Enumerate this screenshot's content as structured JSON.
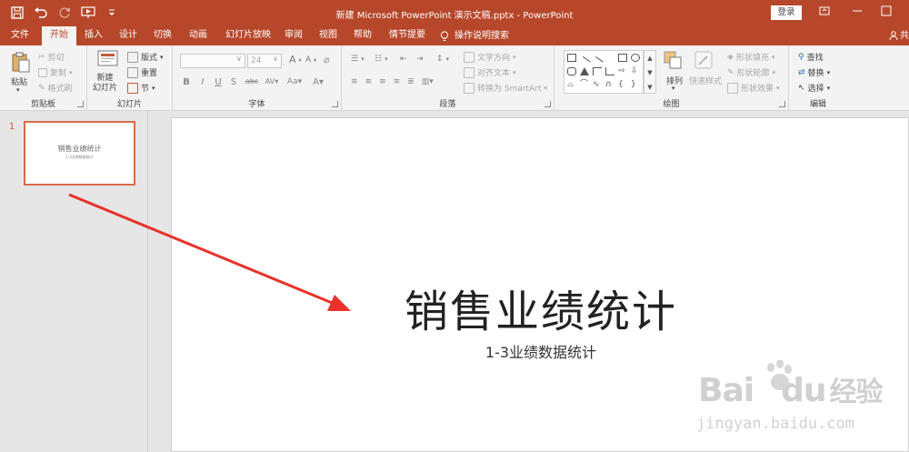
{
  "window": {
    "title": "新建 Microsoft PowerPoint 演示文稿.pptx  -  PowerPoint",
    "signin": "登录",
    "share_partial": "共"
  },
  "tabs": [
    {
      "label": "文件"
    },
    {
      "label": "开始"
    },
    {
      "label": "插入"
    },
    {
      "label": "设计"
    },
    {
      "label": "切换"
    },
    {
      "label": "动画"
    },
    {
      "label": "幻灯片放映"
    },
    {
      "label": "审阅"
    },
    {
      "label": "视图"
    },
    {
      "label": "帮助"
    },
    {
      "label": "情节提要"
    },
    {
      "label": "操作说明搜索"
    }
  ],
  "ribbon": {
    "clipboard": {
      "label": "剪贴板",
      "paste": "粘贴",
      "cut": "剪切",
      "copy": "复制",
      "format_painter": "格式刷"
    },
    "slides": {
      "label": "幻灯片",
      "new_slide_line1": "新建",
      "new_slide_line2": "幻灯片",
      "layout": "版式",
      "reset": "重置",
      "section": "节"
    },
    "font": {
      "label": "字体",
      "font_name": "",
      "font_size": "24",
      "bold": "B",
      "italic": "I",
      "underline": "U",
      "shadow": "S",
      "strike": "abc",
      "spacing": "AV",
      "case": "Aa",
      "grow": "A",
      "shrink": "A",
      "color": "A"
    },
    "paragraph": {
      "label": "段落",
      "text_direction": "文字方向",
      "align_text": "对齐文本",
      "convert_smartart": "转换为 SmartArt"
    },
    "drawing": {
      "label": "绘图",
      "arrange": "排列",
      "quick_styles": "快速样式",
      "shape_fill": "形状填充",
      "shape_outline": "形状轮廓",
      "shape_effects": "形状效果"
    },
    "editing": {
      "label": "编辑",
      "find": "查找",
      "replace": "替换",
      "select": "选择"
    }
  },
  "thumbnails": [
    {
      "number": "1",
      "title": "销售业绩统计",
      "subtitle": "1-3业绩数据统计"
    }
  ],
  "slide": {
    "title": "销售业绩统计",
    "subtitle": "1-3业绩数据统计"
  },
  "watermark": {
    "brand_a": "Bai",
    "brand_b": "du",
    "brand_c": "经验",
    "url": "jingyan.baidu.com"
  },
  "colors": {
    "accent": "#b7472a",
    "annotation_arrow": "#e8322a"
  }
}
